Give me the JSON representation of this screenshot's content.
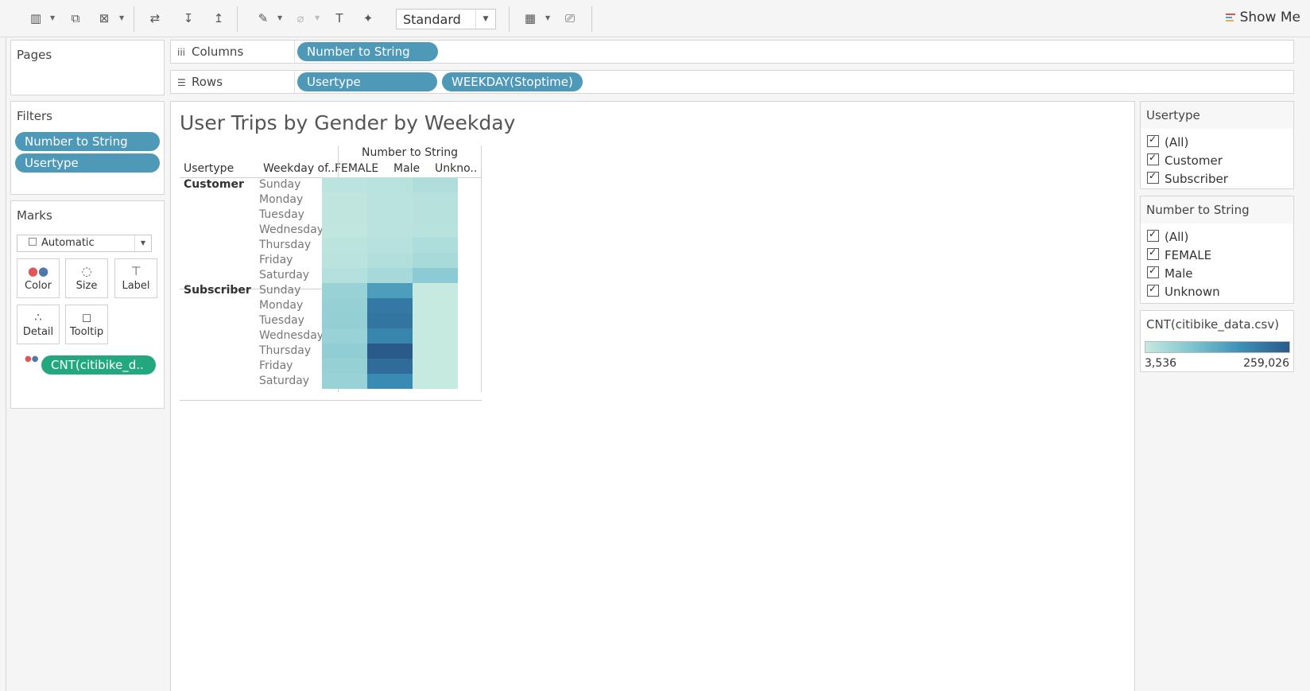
{
  "toolbar": {
    "icons": [
      "new-worksheet-icon",
      "duplicate-icon",
      "clear-sheet-icon",
      "swap-rows-columns-icon",
      "sort-ascending-icon",
      "sort-descending-icon",
      "highlight-icon",
      "group-icon",
      "show-mark-labels-icon",
      "pin-icon",
      "show-cards-icon",
      "presentation-icon"
    ],
    "fit_value": "Standard",
    "show_me_label": "Show Me"
  },
  "pages": {
    "title": "Pages"
  },
  "shelves": {
    "columns_label": "Columns",
    "columns_pills": [
      "Number to String"
    ],
    "rows_label": "Rows",
    "rows_pills": [
      "Usertype",
      "WEEKDAY(Stoptime)"
    ]
  },
  "filters": {
    "title": "Filters",
    "pills": [
      "Number to String",
      "Usertype"
    ]
  },
  "marks": {
    "title": "Marks",
    "mark_type": "Automatic",
    "buttons": [
      "Color",
      "Size",
      "Label",
      "Detail",
      "Tooltip"
    ],
    "field_pill": "CNT(citibike_d.."
  },
  "view": {
    "title": "User Trips by Gender by Weekday",
    "col_group_header": "Number to String",
    "row_header_1": "Usertype",
    "row_header_2": "Weekday of..",
    "columns": [
      "FEMALE",
      "Male",
      "Unkno.."
    ]
  },
  "chart_data": {
    "type": "heatmap",
    "title": "User Trips by Gender by Weekday",
    "measure": "CNT(citibike_data.csv)",
    "columns": [
      "FEMALE",
      "Male",
      "Unknown"
    ],
    "row_groups": [
      {
        "name": "Customer",
        "rows": [
          "Sunday",
          "Monday",
          "Tuesday",
          "Wednesday",
          "Thursday",
          "Friday",
          "Saturday"
        ],
        "values": [
          [
            15000,
            20000,
            30000
          ],
          [
            12000,
            17000,
            22000
          ],
          [
            12000,
            17000,
            22000
          ],
          [
            10000,
            16000,
            20000
          ],
          [
            15000,
            22000,
            30000
          ],
          [
            17000,
            27000,
            38000
          ],
          [
            25000,
            40000,
            70000
          ]
        ]
      },
      {
        "name": "Subscriber",
        "rows": [
          "Sunday",
          "Monday",
          "Tuesday",
          "Wednesday",
          "Thursday",
          "Friday",
          "Saturday"
        ],
        "values": [
          [
            55000,
            150000,
            3536
          ],
          [
            60000,
            210000,
            3600
          ],
          [
            62000,
            215000,
            3800
          ],
          [
            55000,
            190000,
            3700
          ],
          [
            65000,
            259026,
            3800
          ],
          [
            60000,
            230000,
            3700
          ],
          [
            55000,
            180000,
            3536
          ]
        ]
      }
    ],
    "color_range": [
      3536,
      259026
    ]
  },
  "legend_usertype": {
    "title": "Usertype",
    "items": [
      "(All)",
      "Customer",
      "Subscriber"
    ]
  },
  "legend_gender": {
    "title": "Number to String",
    "items": [
      "(All)",
      "FEMALE",
      "Male",
      "Unknown"
    ]
  },
  "legend_color": {
    "title": "CNT(citibike_data.csv)",
    "min_label": "3,536",
    "max_label": "259,026",
    "colors": [
      "#c6e9e0",
      "#7cc3cf",
      "#3b8fb6",
      "#2a5a8a"
    ]
  }
}
